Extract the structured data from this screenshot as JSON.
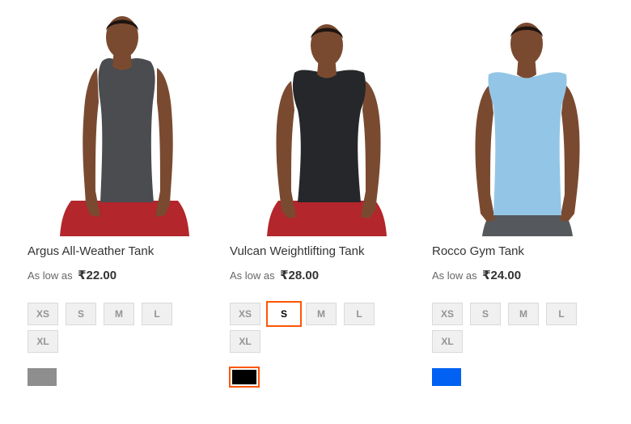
{
  "products": [
    {
      "name": "Argus All-Weather Tank",
      "price_label": "As low as",
      "price": "₹22.00",
      "sizes": [
        "XS",
        "S",
        "M",
        "L",
        "XL"
      ],
      "selected_size": "",
      "color": "#8e8e8e",
      "color_selected": false,
      "shirt_color": "#4a4c50",
      "shorts_color": "#b2262c"
    },
    {
      "name": "Vulcan Weightlifting Tank",
      "price_label": "As low as",
      "price": "₹28.00",
      "sizes": [
        "XS",
        "S",
        "M",
        "L",
        "XL"
      ],
      "selected_size": "S",
      "color": "#000000",
      "color_selected": true,
      "shirt_color": "#25272a",
      "shorts_color": "#b2262c"
    },
    {
      "name": "Rocco Gym Tank",
      "price_label": "As low as",
      "price": "₹24.00",
      "sizes": [
        "XS",
        "S",
        "M",
        "L",
        "XL"
      ],
      "selected_size": "",
      "color": "#0061f2",
      "color_selected": false,
      "shirt_color": "#93c6e6",
      "shorts_color": "#55585c"
    }
  ],
  "colors": {
    "accent_selected_border": "#ff5501",
    "skin": "#7a4a30"
  }
}
